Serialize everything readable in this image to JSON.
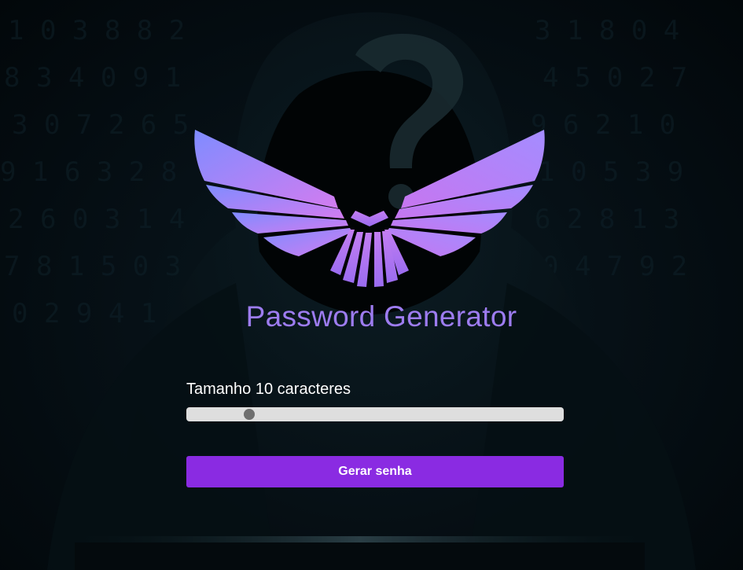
{
  "app": {
    "title": "Password Generator"
  },
  "length_control": {
    "label_prefix": "Tamanho",
    "value": "10",
    "label_suffix": "caracteres",
    "min": 6,
    "max": 32,
    "current": 10
  },
  "actions": {
    "generate_label": "Gerar senha"
  },
  "theme": {
    "accent": "#8a2be2",
    "title_color": "#9d7cf0",
    "logo_gradient": [
      "#7f8cff",
      "#d27cf0"
    ]
  },
  "icons": {
    "logo": "winged-emblem-icon",
    "background": "hooded-figure-question-mark"
  }
}
